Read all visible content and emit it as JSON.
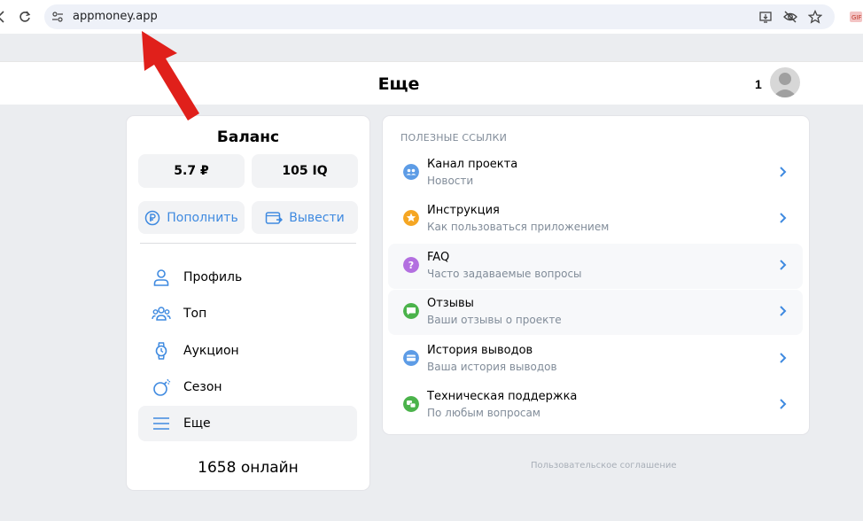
{
  "browser": {
    "url": "appmoney.app"
  },
  "header": {
    "title": "Еще",
    "user_count": "1"
  },
  "balance": {
    "title": "Баланс",
    "rub": "5.7 ₽",
    "iq": "105 IQ",
    "topup_label": "Пополнить",
    "withdraw_label": "Вывести"
  },
  "menu": {
    "items": [
      {
        "label": "Профиль"
      },
      {
        "label": "Топ"
      },
      {
        "label": "Аукцион"
      },
      {
        "label": "Сезон"
      },
      {
        "label": "Еще"
      }
    ],
    "active_index": 4
  },
  "online": "1658 онлайн",
  "links": {
    "section_title": "ПОЛЕЗНЫЕ ССЫЛКИ",
    "items": [
      {
        "title": "Канал проекта",
        "subtitle": "Новости",
        "icon": "users-icon",
        "color": "#5d9ce6"
      },
      {
        "title": "Инструкция",
        "subtitle": "Как пользоваться приложением",
        "icon": "star-icon",
        "color": "#f5a623"
      },
      {
        "title": "FAQ",
        "subtitle": "Часто задаваемые вопросы",
        "icon": "question-icon",
        "color": "#b36fe0"
      },
      {
        "title": "Отзывы",
        "subtitle": "Ваши отзывы о проекте",
        "icon": "message-icon",
        "color": "#4bb34b"
      },
      {
        "title": "История выводов",
        "subtitle": "Ваша история выводов",
        "icon": "wallet-icon",
        "color": "#5d9ce6"
      },
      {
        "title": "Техническая поддержка",
        "subtitle": "По любым вопросам",
        "icon": "support-icon",
        "color": "#4bb34b"
      }
    ]
  },
  "footer": {
    "agreement": "Пользовательское соглашение"
  },
  "colors": {
    "accent": "#3f8ae0",
    "background": "#ebedf0",
    "arrow": "#e0201b"
  }
}
